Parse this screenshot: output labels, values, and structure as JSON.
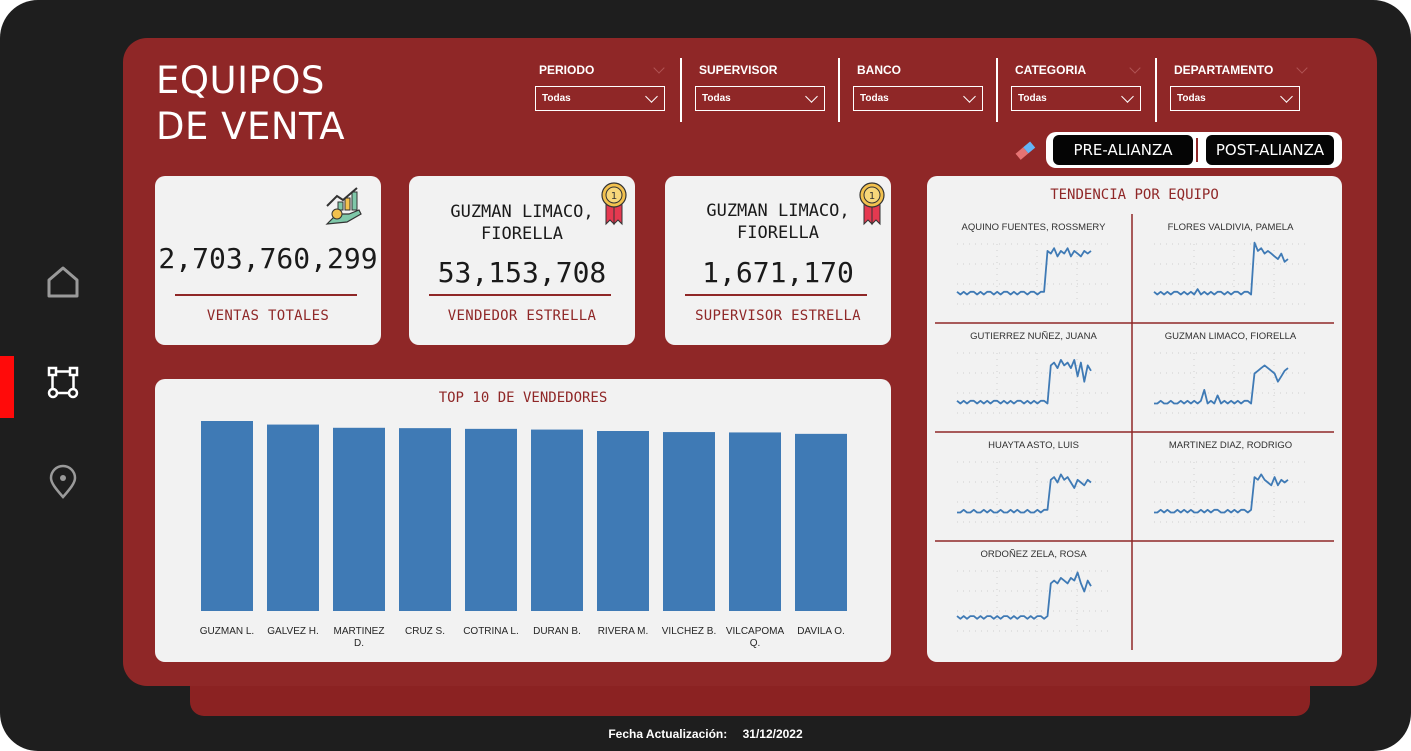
{
  "app": {
    "title_line1": "EQUIPOS",
    "title_line2": "DE VENTA",
    "accent_color": "#8f2727",
    "bar_color": "#3f7ab5"
  },
  "nav": {
    "items": [
      {
        "icon": "home-icon",
        "active": false
      },
      {
        "icon": "flow-icon",
        "active": true
      },
      {
        "icon": "location-pin-icon",
        "active": false
      }
    ]
  },
  "filters": [
    {
      "label": "PERIODO",
      "value": "Todas"
    },
    {
      "label": "SUPERVISOR",
      "value": "Todas"
    },
    {
      "label": "BANCO",
      "value": "Todas"
    },
    {
      "label": "CATEGORIA",
      "value": "Todas"
    },
    {
      "label": "DEPARTAMENTO",
      "value": "Todas"
    }
  ],
  "toggle": {
    "pre_label": "PRE-ALIANZA",
    "post_label": "POST-ALIANZA"
  },
  "kpis": {
    "total": {
      "value": "2,703,760,299",
      "label": "VENTAS TOTALES",
      "icon": "sales-growth-icon"
    },
    "seller": {
      "name_line1": "GUZMAN LIMACO,",
      "name_line2": "FIORELLA",
      "value": "53,153,708",
      "label": "VENDEDOR ESTRELLA",
      "icon": "medal-icon"
    },
    "supervisor": {
      "name_line1": "GUZMAN LIMACO,",
      "name_line2": "FIORELLA",
      "value": "1,671,170",
      "label": "SUPERVISOR ESTRELLA",
      "icon": "medal-icon"
    }
  },
  "chart_data": [
    {
      "type": "bar",
      "title": "TOP 10 DE VENDEDORES",
      "categories": [
        "GUZMAN L.",
        "GALVEZ H.",
        "MARTINEZ D.",
        "CRUZ S.",
        "COTRINA L.",
        "DURAN B.",
        "RIVERA M.",
        "VILCHEZ B.",
        "VILCAPOMA Q.",
        "DAVILA O."
      ],
      "values": [
        53.2,
        52.2,
        51.3,
        51.2,
        51.0,
        50.8,
        50.4,
        50.1,
        50.0,
        49.6
      ],
      "ylim": [
        0,
        53.2
      ],
      "grid": false
    },
    {
      "type": "line",
      "title": "TENDENCIA POR EQUIPO",
      "series": [
        {
          "name": "AQUINO FUENTES, ROSSMERY",
          "values": [
            3,
            2,
            3,
            2,
            3,
            3,
            2,
            3,
            2,
            3,
            3,
            2,
            3,
            2,
            3,
            3,
            2,
            3,
            2,
            3,
            3,
            2,
            3,
            3,
            2,
            3,
            3,
            18,
            17,
            19,
            16,
            18,
            17,
            19,
            16,
            18,
            17,
            16,
            18,
            17,
            18
          ]
        },
        {
          "name": "FLORES VALDIVIA, PAMELA",
          "values": [
            3,
            2,
            3,
            2,
            3,
            2,
            3,
            3,
            2,
            3,
            2,
            3,
            2,
            4,
            2,
            3,
            2,
            3,
            2,
            3,
            3,
            2,
            3,
            2,
            3,
            3,
            2,
            3,
            3,
            2,
            21,
            18,
            19,
            17,
            18,
            17,
            16,
            15,
            17,
            14,
            15
          ]
        },
        {
          "name": "GUTIERREZ NUÑEZ, JUANA",
          "values": [
            3,
            2,
            3,
            2,
            3,
            3,
            2,
            3,
            2,
            3,
            2,
            3,
            3,
            2,
            3,
            2,
            3,
            2,
            3,
            3,
            2,
            3,
            2,
            3,
            2,
            3,
            3,
            2,
            16,
            17,
            15,
            18,
            16,
            17,
            15,
            18,
            12,
            17,
            10,
            16,
            14
          ]
        },
        {
          "name": "GUZMAN LIMACO, FIORELLA",
          "values": [
            2,
            2,
            3,
            2,
            2,
            3,
            2,
            2,
            3,
            2,
            3,
            2,
            3,
            2,
            3,
            7,
            2,
            3,
            2,
            5,
            2,
            3,
            2,
            3,
            2,
            3,
            2,
            3,
            3,
            2,
            13,
            14,
            15,
            16,
            15,
            14,
            13,
            10,
            12,
            14,
            15
          ]
        },
        {
          "name": "HUAYTA ASTO, LUIS",
          "values": [
            2,
            2,
            3,
            2,
            2,
            3,
            2,
            2,
            3,
            2,
            3,
            2,
            2,
            3,
            2,
            2,
            3,
            2,
            3,
            2,
            2,
            3,
            2,
            2,
            3,
            2,
            3,
            3,
            14,
            15,
            13,
            16,
            14,
            15,
            13,
            11,
            14,
            13,
            12,
            14,
            13
          ]
        },
        {
          "name": "MARTINEZ DIAZ, RODRIGO",
          "values": [
            2,
            2,
            3,
            2,
            3,
            2,
            2,
            3,
            2,
            3,
            2,
            3,
            2,
            2,
            3,
            2,
            3,
            2,
            3,
            3,
            2,
            2,
            3,
            2,
            3,
            2,
            3,
            3,
            2,
            3,
            15,
            14,
            16,
            14,
            13,
            12,
            15,
            12,
            14,
            13,
            14
          ]
        },
        {
          "name": "ORDOÑEZ ZELA, ROSA",
          "values": [
            4,
            3,
            4,
            3,
            4,
            4,
            3,
            4,
            3,
            4,
            4,
            3,
            4,
            3,
            4,
            4,
            3,
            4,
            3,
            4,
            4,
            3,
            4,
            3,
            4,
            4,
            3,
            4,
            16,
            17,
            16,
            18,
            17,
            16,
            18,
            17,
            20,
            16,
            13,
            17,
            15
          ]
        }
      ],
      "grid": true
    }
  ],
  "footer": {
    "label": "Fecha Actualización:",
    "date": "31/12/2022"
  }
}
